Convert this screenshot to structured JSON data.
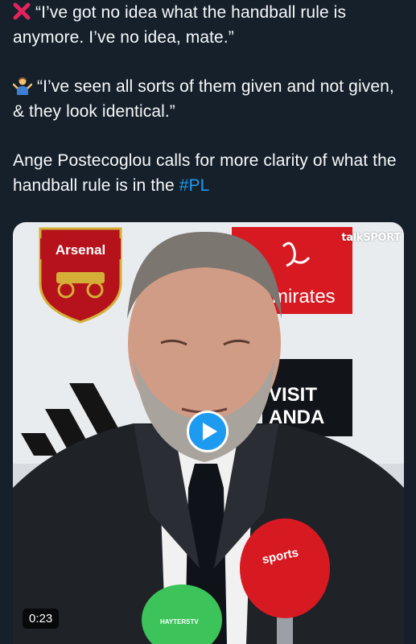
{
  "tweet": {
    "line1_icon": "red-cross-emoji",
    "quote1": "“I’ve got no idea what the handball rule is anymore. I’ve no idea, mate.”",
    "line2_icon": "person-shrugging-emoji",
    "quote2": "“I’ve seen all sorts of them given and not given, & they look identical.”",
    "body_prefix": "Ange Postecoglou calls for more clarity of what the handball rule is in the ",
    "hashtag": "#PL"
  },
  "media": {
    "broadcaster": "talkSPORT",
    "club_crest_text": "Arsenal",
    "sponsor_text": "mirates",
    "visit_text_1": "VISIT",
    "visit_text_2": "ANDA",
    "mic_red_label": "sports",
    "mic_green_label": "HAYTERSTV",
    "duration": "0:23",
    "play_icon": "play-icon"
  },
  "colors": {
    "background": "#15202b",
    "text": "#f7f9f9",
    "link": "#1d9bf0"
  }
}
